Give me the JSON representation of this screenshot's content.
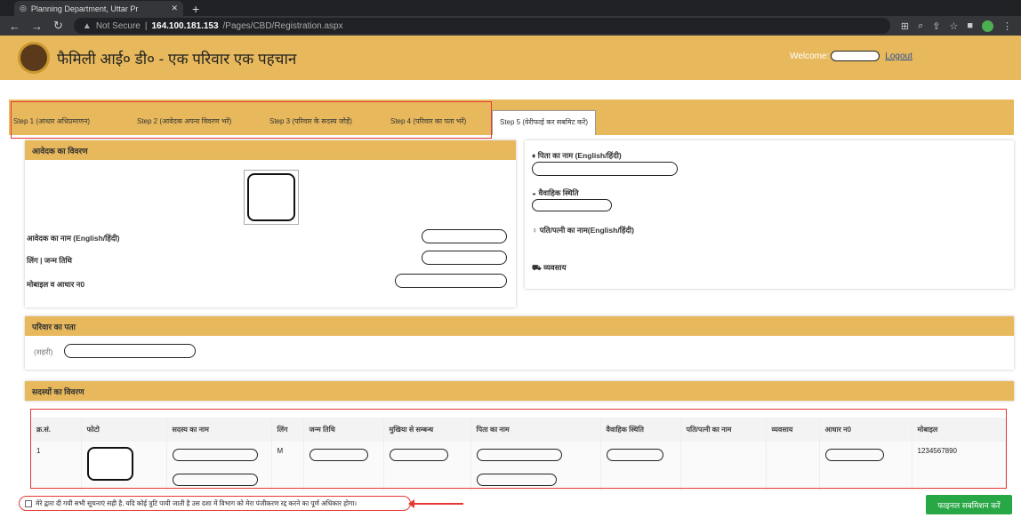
{
  "browser": {
    "tab_title": "Planning Department, Uttar Pr",
    "security": "Not Secure",
    "host": "164.100.181.153",
    "path": "/Pages/CBD/Registration.aspx"
  },
  "site": {
    "title": "फैमिली आई० डी० - एक परिवार एक पहचान",
    "welcome": "Welcome:",
    "logout": "Logout"
  },
  "steps": [
    "Step 1 (आधार अधिप्रमाणन)",
    "Step 2 (आवेदक अपना विवरण भरें)",
    "Step 3 (परिवार के सदस्य जोड़ें)",
    "Step 4 (परिवार का पता भरें)",
    "Step 5 (वेरीफाई कर सबमिट करें)"
  ],
  "applicant": {
    "heading": "आवेदक का विवरण",
    "name_label": "आवेदक का नाम (English/हिंदी)",
    "gender_dob_label": "लिंग | जन्म तिथि",
    "mobile_aadhaar_label": "मोबाइल व आधार न0"
  },
  "right_panel": {
    "father_label": "पिता का नाम (English/हिंदी)",
    "marital_label": "वैवाहिक स्थिति",
    "spouse_label": "पति/पत्नी का नाम(English/हिंदी)",
    "occupation_label": "व्यवसाय"
  },
  "address": {
    "heading": "परिवार का पता",
    "city_label": "(शहरी)"
  },
  "members": {
    "heading": "सदस्यों का विवरण",
    "columns": [
      "क्र.सं.",
      "फोटो",
      "सदस्य का नाम",
      "लिंग",
      "जन्म तिथि",
      "मुखिया से सम्बन्ध",
      "पिता का नाम",
      "वैवाहिक स्थिति",
      "पति/पत्नी का नाम",
      "व्यवसाय",
      "आधार न0",
      "मोबाइल"
    ],
    "rows": [
      {
        "sn": "1",
        "gender": "M",
        "mobile": "1234567890"
      }
    ]
  },
  "consent_text": "मेरे द्वारा दी गयी सभी सूचनाएं सही है, यदि कोई त्रुटि पायी जाती है उस दशा में विभाग को मेरा पंजीकरण रद्द करने का पूर्ण अधिकार होगा।",
  "submit_label": "फाइनल सबमिशन करें",
  "colors": {
    "header": "#e8b95c",
    "highlight": "#e53935",
    "submit": "#28a745"
  }
}
